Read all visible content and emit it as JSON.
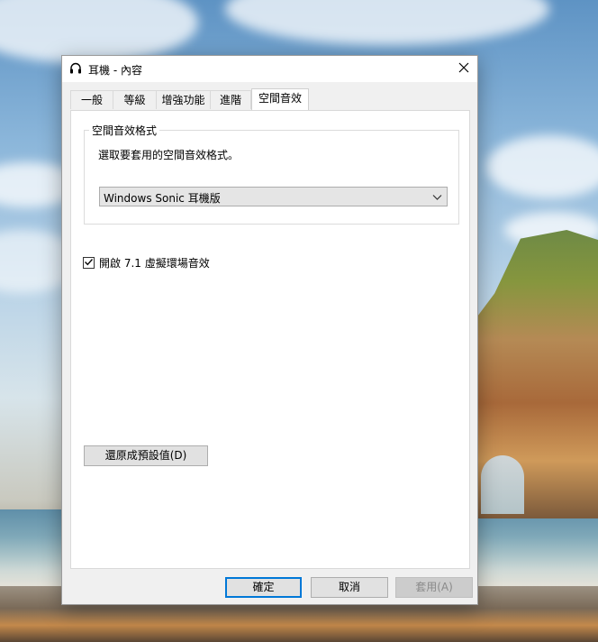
{
  "window": {
    "title": "耳機 - 內容",
    "close_label": "×"
  },
  "tabs": [
    {
      "label": "一般",
      "active": false
    },
    {
      "label": "等級",
      "active": false
    },
    {
      "label": "增強功能",
      "active": false
    },
    {
      "label": "進階",
      "active": false
    },
    {
      "label": "空間音效",
      "active": true
    }
  ],
  "spatial": {
    "group_title": "空間音效格式",
    "description": "選取要套用的空間音效格式。",
    "selected_format": "Windows Sonic 耳機版"
  },
  "virtual_surround": {
    "label": "開啟 7.1 虛擬環場音效",
    "checked": true
  },
  "buttons": {
    "restore": "還原成預設值(D)",
    "ok": "確定",
    "cancel": "取消",
    "apply": "套用(A)"
  },
  "colors": {
    "focus_border": "#0078d7",
    "dialog_bg": "#f0f0f0"
  }
}
